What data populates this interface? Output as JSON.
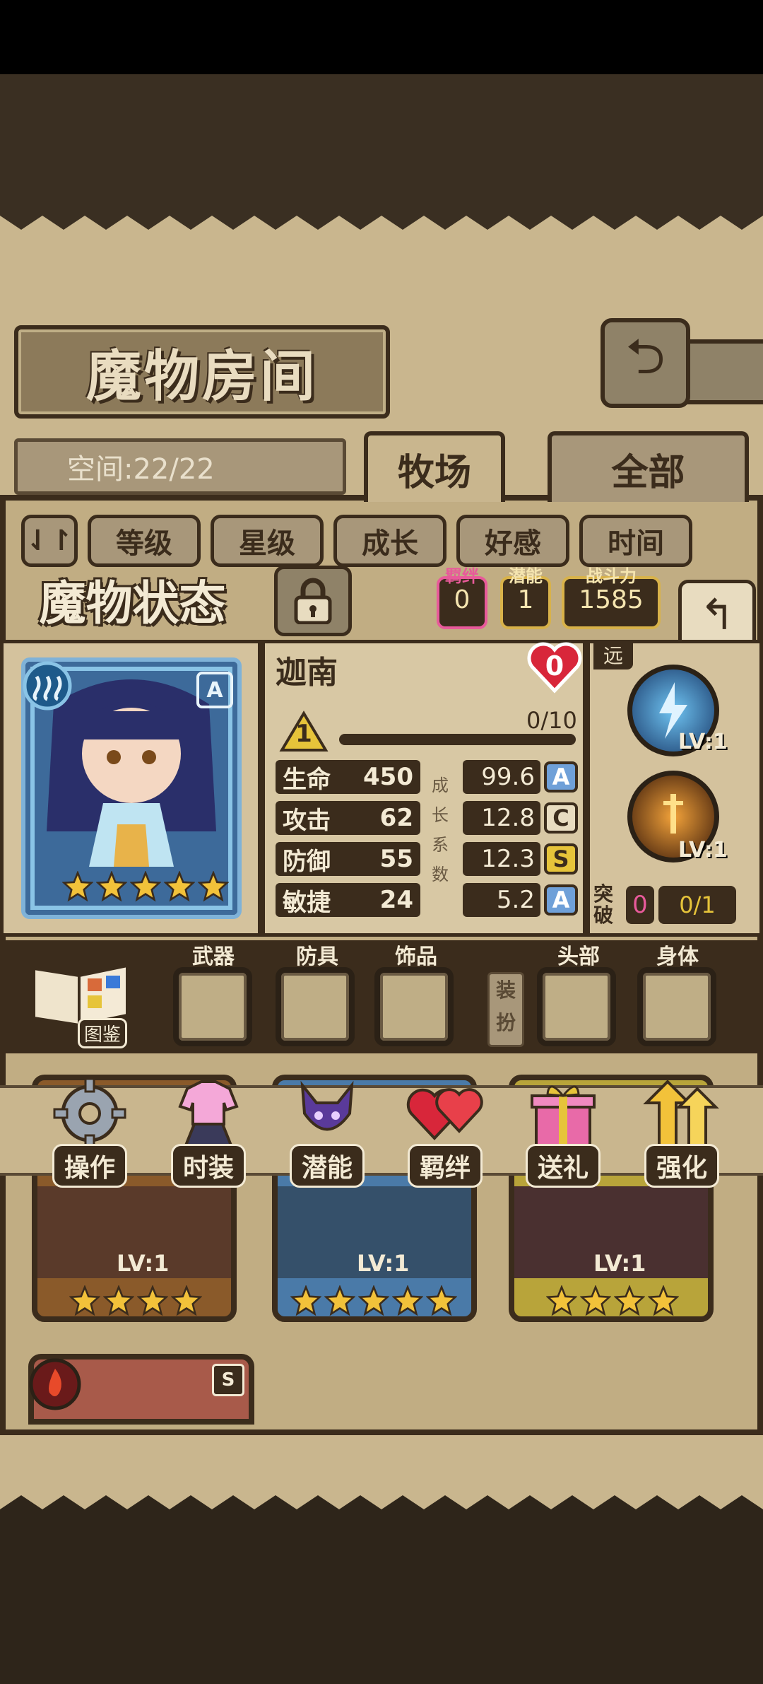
{
  "title": "魔物房间",
  "space": {
    "label": "空间:22/22"
  },
  "tabs": [
    {
      "label": "牧场",
      "active": true
    },
    {
      "label": "全部",
      "active": false
    }
  ],
  "sort_buttons": [
    "等级",
    "星级",
    "成长",
    "好感",
    "时间"
  ],
  "status_panel": {
    "title": "魔物状态",
    "bond": {
      "label": "羁绊",
      "value": "0"
    },
    "potential": {
      "label": "潜能",
      "value": "1"
    },
    "power": {
      "label": "战斗力",
      "value": "1585"
    }
  },
  "monster": {
    "name": "迦南",
    "rank": "A",
    "stars": 5,
    "affection": "0",
    "level": "1",
    "xp": "0/10",
    "xp_fraction": 0.0,
    "growth_label": [
      "成",
      "长",
      "系",
      "数"
    ],
    "stats": [
      {
        "name": "生命",
        "value": "450",
        "growth": "99.6",
        "grade": "A"
      },
      {
        "name": "攻击",
        "value": "62",
        "growth": "12.8",
        "grade": "C"
      },
      {
        "name": "防御",
        "value": "55",
        "growth": "12.3",
        "grade": "S"
      },
      {
        "name": "敏捷",
        "value": "24",
        "growth": "5.2",
        "grade": "A"
      }
    ],
    "range_type": "远",
    "skills": [
      {
        "level": "LV:1"
      },
      {
        "level": "LV:1"
      }
    ],
    "breakthrough": {
      "label": "突破",
      "count": "0",
      "progress": "0/1"
    }
  },
  "equipment": {
    "book_label": "图鉴",
    "slots": [
      "武器",
      "防具",
      "饰品",
      "头部",
      "身体"
    ],
    "equip_button": "装扮"
  },
  "actions": [
    "操作",
    "时装",
    "潜能",
    "羁绊",
    "送礼",
    "强化"
  ],
  "list_cards": [
    {
      "level": "LV:1",
      "stars": 4
    },
    {
      "level": "LV:1",
      "stars": 5
    },
    {
      "level": "LV:1",
      "stars": 4
    }
  ],
  "partial_card": {
    "grade": "S"
  },
  "colors": {
    "accent_gold": "#d8b24a",
    "grade_A": "#6fa0d8",
    "grade_C": "#e8dcc0",
    "grade_S": "#e6c43a",
    "bond_pink": "#e85a9a"
  }
}
